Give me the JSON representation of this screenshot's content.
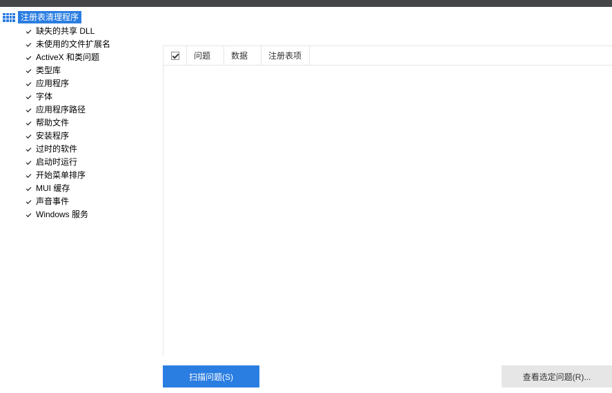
{
  "sidebar": {
    "root_label": "注册表清理程序",
    "items": [
      {
        "label": "缺失的共享 DLL"
      },
      {
        "label": "未使用的文件扩展名"
      },
      {
        "label": "ActiveX 和类问题"
      },
      {
        "label": "类型库"
      },
      {
        "label": "应用程序"
      },
      {
        "label": "字体"
      },
      {
        "label": "应用程序路径"
      },
      {
        "label": "帮助文件"
      },
      {
        "label": "安装程序"
      },
      {
        "label": "过时的软件"
      },
      {
        "label": "启动时运行"
      },
      {
        "label": "开始菜单排序"
      },
      {
        "label": "MUI 缓存"
      },
      {
        "label": "声音事件"
      },
      {
        "label": "Windows 服务"
      }
    ]
  },
  "table": {
    "columns": {
      "c1": "问题",
      "c2": "数据",
      "c3": "注册表项"
    }
  },
  "footer": {
    "scan_label": "扫描问题(S)",
    "review_label": "查看选定问题(R)..."
  },
  "colors": {
    "accent": "#2a7de1",
    "topbar": "#454647"
  }
}
